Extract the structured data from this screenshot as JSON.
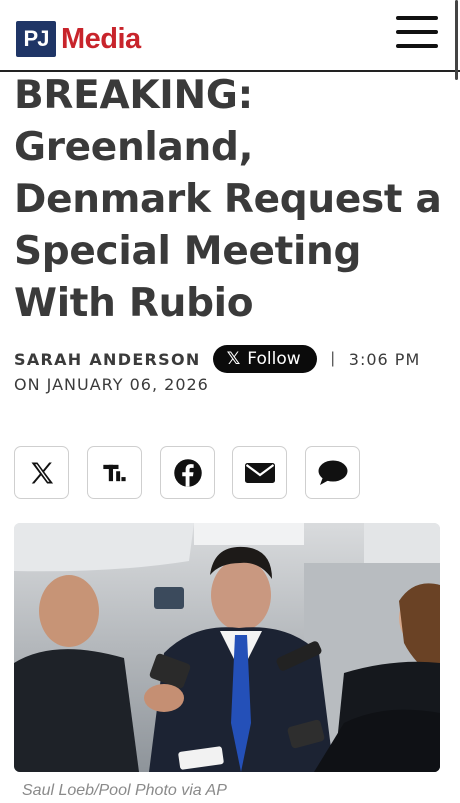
{
  "header": {
    "logo_pj": "PJ",
    "logo_media": "Media",
    "brand_colors": {
      "navy": "#1f3566",
      "red": "#c8242b"
    },
    "menu_icon": "hamburger-menu-icon"
  },
  "article": {
    "headline": "BREAKING: Greenland, Denmark Request a Special Meeting With Rubio",
    "author": "SARAH ANDERSON",
    "follow_x": "𝕏",
    "follow_label": "Follow",
    "separator": "|",
    "time": "3:06 PM",
    "date": "ON JANUARY 06, 2026"
  },
  "share_buttons": [
    {
      "name": "share-x-button",
      "icon": "x-logo-icon"
    },
    {
      "name": "share-truth-social-button",
      "icon": "truth-social-icon"
    },
    {
      "name": "share-facebook-button",
      "icon": "facebook-icon"
    },
    {
      "name": "share-email-button",
      "icon": "envelope-icon"
    },
    {
      "name": "share-comment-button",
      "icon": "speech-bubble-icon"
    }
  ],
  "photo": {
    "caption": "Saul Loeb/Pool Photo via AP"
  }
}
